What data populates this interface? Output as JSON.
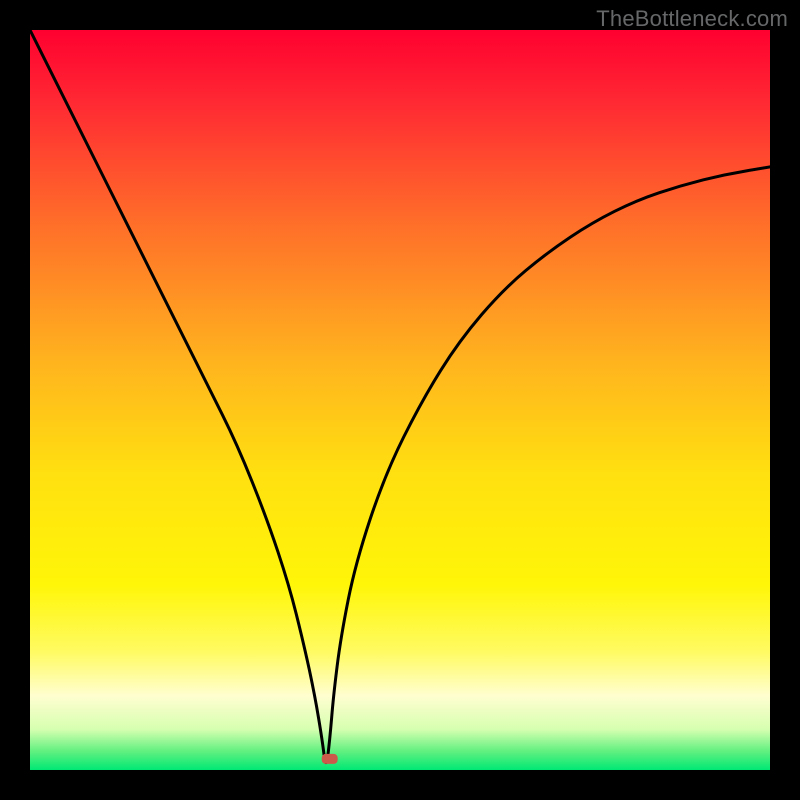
{
  "watermark": "TheBottleneck.com",
  "chart_data": {
    "type": "line",
    "title": "",
    "xlabel": "",
    "ylabel": "",
    "xlim": [
      0,
      100
    ],
    "ylim": [
      0,
      100
    ],
    "background": {
      "type": "vertical-gradient",
      "stops": [
        {
          "pos": 0.0,
          "color": "#ff0030"
        },
        {
          "pos": 0.1,
          "color": "#ff2a33"
        },
        {
          "pos": 0.25,
          "color": "#ff6a2a"
        },
        {
          "pos": 0.45,
          "color": "#ffb41e"
        },
        {
          "pos": 0.6,
          "color": "#ffe010"
        },
        {
          "pos": 0.75,
          "color": "#fff608"
        },
        {
          "pos": 0.84,
          "color": "#fffb62"
        },
        {
          "pos": 0.9,
          "color": "#fffed0"
        },
        {
          "pos": 0.945,
          "color": "#d6ffb0"
        },
        {
          "pos": 0.975,
          "color": "#60f080"
        },
        {
          "pos": 1.0,
          "color": "#00e874"
        }
      ]
    },
    "series": [
      {
        "name": "bottleneck-curve",
        "x": [
          0,
          2,
          5,
          8,
          12,
          16,
          20,
          24,
          28,
          32,
          35,
          37,
          38.5,
          39.5,
          40,
          40.5,
          41,
          42,
          44,
          48,
          53,
          58,
          64,
          70,
          76,
          82,
          88,
          94,
          100
        ],
        "y": [
          100,
          96,
          90,
          84,
          76,
          68,
          60,
          52,
          44,
          34,
          25,
          17,
          10,
          4,
          0,
          4,
          10,
          18,
          28,
          40,
          50,
          58,
          65,
          70,
          74,
          77,
          79,
          80.5,
          81.5
        ]
      }
    ],
    "marker": {
      "name": "optimal-point",
      "x": 40.5,
      "y": 1.5,
      "color": "#cc5a4a",
      "shape": "rounded-rect"
    },
    "frame_color": "#000000"
  }
}
